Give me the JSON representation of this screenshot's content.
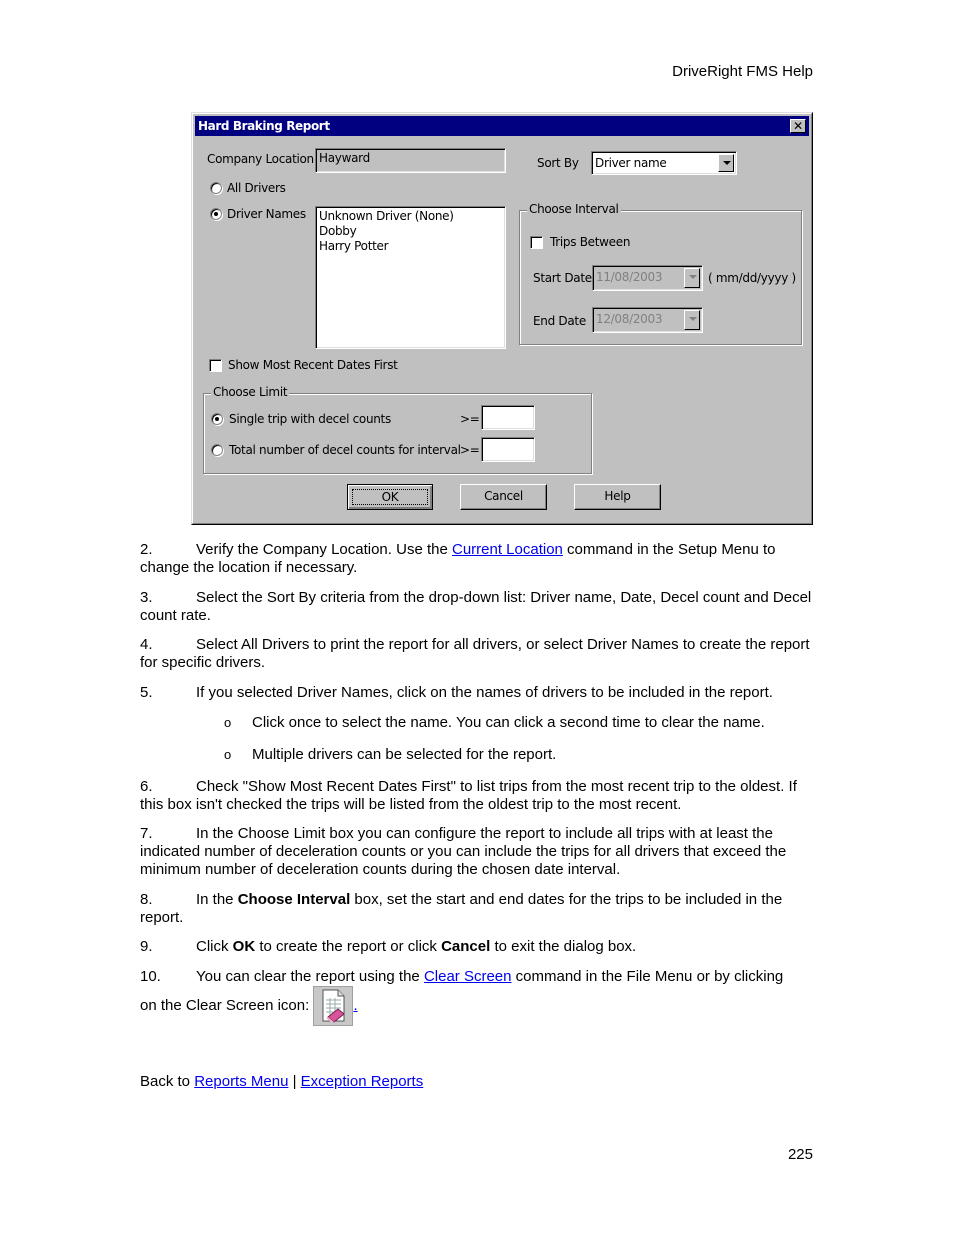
{
  "page_header": "DriveRight FMS Help",
  "page_number": "225",
  "dialog": {
    "title": "Hard Braking Report",
    "close_glyph": "✕",
    "company_location_label": "Company Location",
    "company_location_value": "Hayward",
    "sort_by_label": "Sort By",
    "sort_by_value": "Driver name",
    "all_drivers_label": "All Drivers",
    "all_drivers_selected": false,
    "driver_names_label": "Driver Names",
    "driver_names_selected": true,
    "drivers": [
      "Unknown Driver (None)",
      "Dobby",
      "Harry Potter"
    ],
    "choose_interval": {
      "legend": "Choose Interval",
      "trips_between_label": "Trips Between",
      "trips_between_checked": false,
      "start_date_label": "Start Date",
      "start_date_value": "11/08/2003",
      "date_format_hint": "( mm/dd/yyyy )",
      "end_date_label": "End Date",
      "end_date_value": "12/08/2003"
    },
    "show_recent_label": "Show Most Recent Dates First",
    "show_recent_checked": false,
    "choose_limit": {
      "legend": "Choose Limit",
      "single_trip_label": "Single trip with decel counts",
      "single_trip_selected": true,
      "total_label": "Total number of decel counts for interval",
      "total_selected": false,
      "operator": ">=",
      "single_trip_value": "",
      "total_value": ""
    },
    "buttons": {
      "ok": "OK",
      "cancel": "Cancel",
      "help": "Help"
    }
  },
  "steps": [
    {
      "num": "2.",
      "pre": "Verify the Company Location. Use the ",
      "link": "Current Location",
      "post": " command in the Setup Menu to change the location if necessary."
    },
    {
      "num": "3.",
      "text": "Select the Sort By criteria from the drop-down list: Driver name, Date, Decel count and Decel count rate."
    },
    {
      "num": "4.",
      "text": "Select All Drivers to print the report for all drivers, or select Driver Names to create the report for specific drivers."
    },
    {
      "num": "5.",
      "text": "If you selected Driver Names, click on the names of drivers to be included in the report."
    },
    {
      "num": "6.",
      "text": "Check \"Show Most Recent Dates First\" to list trips from the most recent trip to the oldest. If this box isn't checked the trips will be listed from the oldest trip to the most recent."
    },
    {
      "num": "7.",
      "text": "In the Choose Limit box you can configure the report to include all trips with at least the indicated number of deceleration counts or you can include the trips for all drivers that exceed the minimum number of deceleration counts during the chosen date interval."
    },
    {
      "num": "8.",
      "pre": "In the ",
      "bold": "Choose Interval",
      "post": " box, set the start and end dates for the trips to be included in the report."
    },
    {
      "num": "9.",
      "pre": "Click ",
      "bold1": "OK",
      "mid": " to create the report or click ",
      "bold2": "Cancel",
      "post": " to exit the dialog box."
    },
    {
      "num": "10.",
      "pre": "You can clear the report using the ",
      "link": "Clear Screen",
      "post": " command in the File Menu or by clicking",
      "line2": "on the Clear Screen icon: ",
      "icon": "clear-screen-icon",
      "tail_link": "."
    }
  ],
  "bullets": [
    {
      "glyph": "o",
      "text": "Click once to select the name. You can click a second time to clear the name."
    },
    {
      "glyph": "o",
      "text": "Multiple drivers can be selected for the report."
    }
  ],
  "footer_nav": {
    "prefix": "Back to ",
    "link1": "Reports Menu",
    "separator": " | ",
    "link2": "Exception Reports"
  }
}
